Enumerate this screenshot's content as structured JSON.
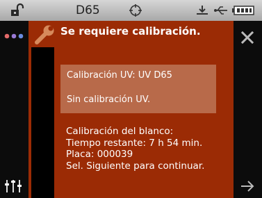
{
  "status_bar": {
    "illuminant": "D65",
    "icons": [
      "unlock-icon",
      "target-icon",
      "usb-icon",
      "battery-icon"
    ]
  },
  "sidebar_left": {
    "icons": [
      "status-dots-icon",
      "sliders-icon"
    ]
  },
  "sidebar_right": {
    "icons": [
      "close-icon",
      "next-arrow-icon"
    ]
  },
  "message": {
    "title": "Se requiere calibración.",
    "icon": "wrench-icon",
    "uv_calibration": "Calibración UV: UV D65",
    "uv_status": "Sin calibración UV.",
    "white_calibration_label": "Calibración del blanco:",
    "time_remaining": "Tiempo restante: 7 h 54 min.",
    "plate": "Placa: 000039",
    "instruction": "Sel. Siguiente para continuar."
  },
  "colors": {
    "accent": "#9b2b05",
    "uv_box": "#b86a4a",
    "status_bar": "#c0c0c0",
    "sidebar": "#0c0c0c"
  }
}
